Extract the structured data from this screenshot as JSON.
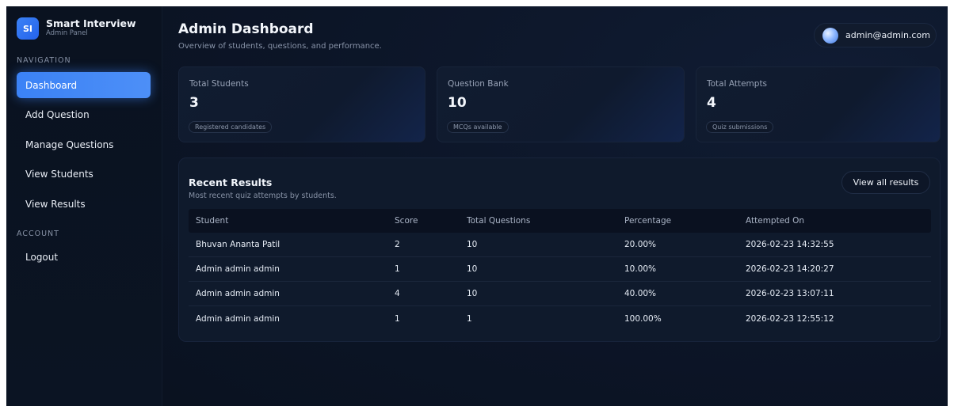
{
  "brand": {
    "badge": "SI",
    "title": "Smart Interview",
    "subtitle": "Admin Panel"
  },
  "sidebar": {
    "nav_heading": "NAVIGATION",
    "items": [
      {
        "label": "Dashboard",
        "active": true
      },
      {
        "label": "Add Question"
      },
      {
        "label": "Manage Questions"
      },
      {
        "label": "View Students"
      },
      {
        "label": "View Results"
      }
    ],
    "account_heading": "ACCOUNT",
    "account_items": [
      {
        "label": "Logout"
      }
    ]
  },
  "header": {
    "title": "Admin Dashboard",
    "subtitle": "Overview of students, questions, and performance.",
    "user_email": "admin@admin.com"
  },
  "stats": [
    {
      "label": "Total Students",
      "value": "3",
      "pill": "Registered candidates"
    },
    {
      "label": "Question Bank",
      "value": "10",
      "pill": "MCQs available"
    },
    {
      "label": "Total Attempts",
      "value": "4",
      "pill": "Quiz submissions"
    }
  ],
  "results": {
    "title": "Recent Results",
    "subtitle": "Most recent quiz attempts by students.",
    "view_all_label": "View all results",
    "columns": [
      "Student",
      "Score",
      "Total Questions",
      "Percentage",
      "Attempted On"
    ],
    "rows": [
      [
        "Bhuvan Ananta Patil",
        "2",
        "10",
        "20.00%",
        "2026-02-23 14:32:55"
      ],
      [
        "Admin admin admin",
        "1",
        "10",
        "10.00%",
        "2026-02-23 14:20:27"
      ],
      [
        "Admin admin admin",
        "4",
        "10",
        "40.00%",
        "2026-02-23 13:07:11"
      ],
      [
        "Admin admin admin",
        "1",
        "1",
        "100.00%",
        "2026-02-23 12:55:12"
      ]
    ]
  },
  "colors": {
    "accent": "#3b82f6",
    "background": "#0b1322"
  }
}
